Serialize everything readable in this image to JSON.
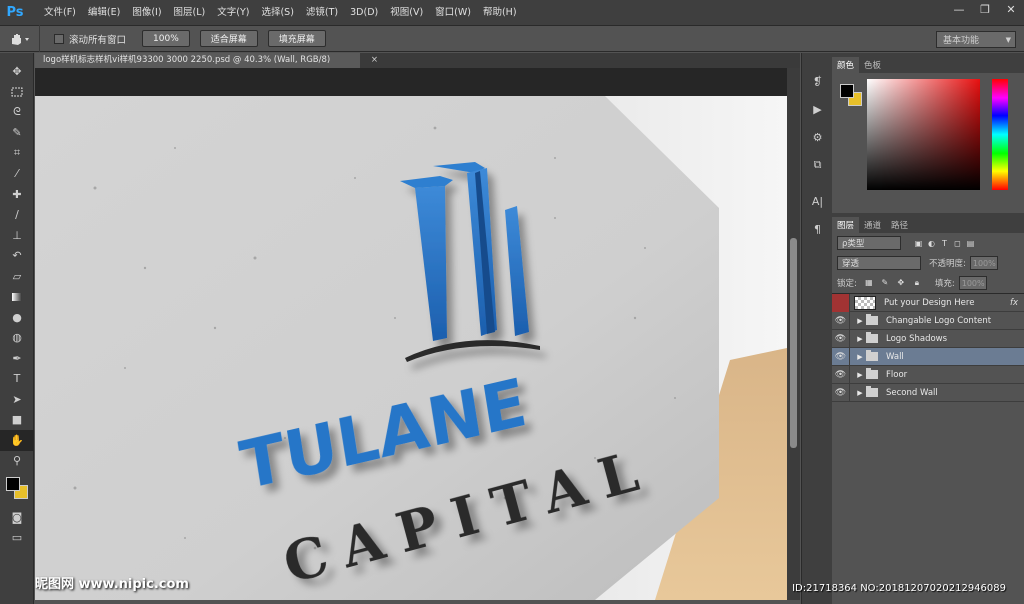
{
  "app": {
    "logo": "Ps"
  },
  "menu": [
    "文件(F)",
    "编辑(E)",
    "图像(I)",
    "图层(L)",
    "文字(Y)",
    "选择(S)",
    "滤镜(T)",
    "3D(D)",
    "视图(V)",
    "窗口(W)",
    "帮助(H)"
  ],
  "window_controls": {
    "minimize": "—",
    "restore": "❐",
    "close": "✕"
  },
  "options": {
    "scroll_all_label": "滚动所有窗口",
    "zoom_100": "100%",
    "fit_screen": "适合屏幕",
    "fill_screen": "填充屏幕",
    "workspace": "基本功能"
  },
  "document": {
    "tab_title": "logo样机标志样机vi样机93300 3000 2250.psd @ 40.3% (Wall, RGB/8)",
    "close": "×"
  },
  "artwork": {
    "logo_word1": "TULANE",
    "logo_word2": "CAPITAL"
  },
  "panels": {
    "color_tabs": [
      "颜色",
      "色板"
    ],
    "layer_tabs": [
      "图层",
      "通道",
      "路径"
    ],
    "kind_label": "ρ类型",
    "blend_mode": "穿透",
    "opacity_label": "不透明度:",
    "opacity_value": "100%",
    "lock_label": "锁定:",
    "fill_label": "填充:",
    "fill_value": "100%"
  },
  "colors": {
    "foreground": "#000000",
    "background": "#e8c02a",
    "accent_blue": "#2b78c8"
  },
  "layers": [
    {
      "name": "Put your Design Here",
      "type": "smart-object",
      "visible": false,
      "fx": "fx"
    },
    {
      "name": "Changable Logo Content",
      "type": "group",
      "visible": true
    },
    {
      "name": "Logo Shadows",
      "type": "group",
      "visible": true
    },
    {
      "name": "Wall",
      "type": "group",
      "visible": true,
      "selected": true
    },
    {
      "name": "Floor",
      "type": "group",
      "visible": true
    },
    {
      "name": "Second Wall",
      "type": "group",
      "visible": true
    }
  ],
  "overlay": {
    "watermark": "昵图网 www.nipic.com",
    "id_text": "ID:21718364 NO:20181207020212946089"
  }
}
